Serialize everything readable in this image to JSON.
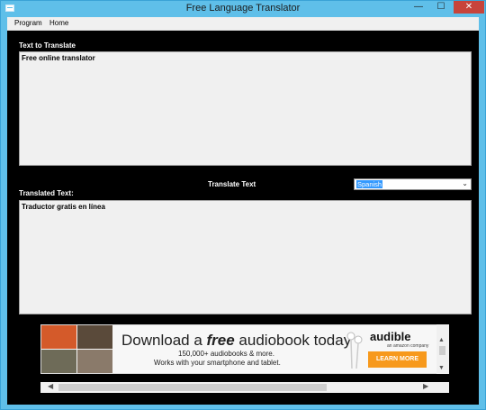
{
  "window": {
    "title": "Free Language Translator"
  },
  "menu": {
    "items": [
      "Program",
      "Home"
    ]
  },
  "source": {
    "label": "Text to Translate",
    "value": "Free online translator"
  },
  "translate": {
    "button_label": "Translate Text"
  },
  "language": {
    "selected": "Spanish"
  },
  "target": {
    "label": "Translated Text:",
    "value": "Traductor gratis en línea"
  },
  "ad": {
    "headline_prefix": "Download a ",
    "headline_em": "free",
    "headline_suffix": " audiobook today",
    "line1": "150,000+ audiobooks & more.",
    "line2": "Works with your smartphone and tablet.",
    "brand": "audible",
    "brand_sub": "an amazon company",
    "cta": "LEARN MORE"
  },
  "colors": {
    "titlebar": "#5fbfe9",
    "client_bg": "#000000",
    "selection": "#3399ff",
    "cta": "#f7991c",
    "close_button": "#c7443b"
  }
}
